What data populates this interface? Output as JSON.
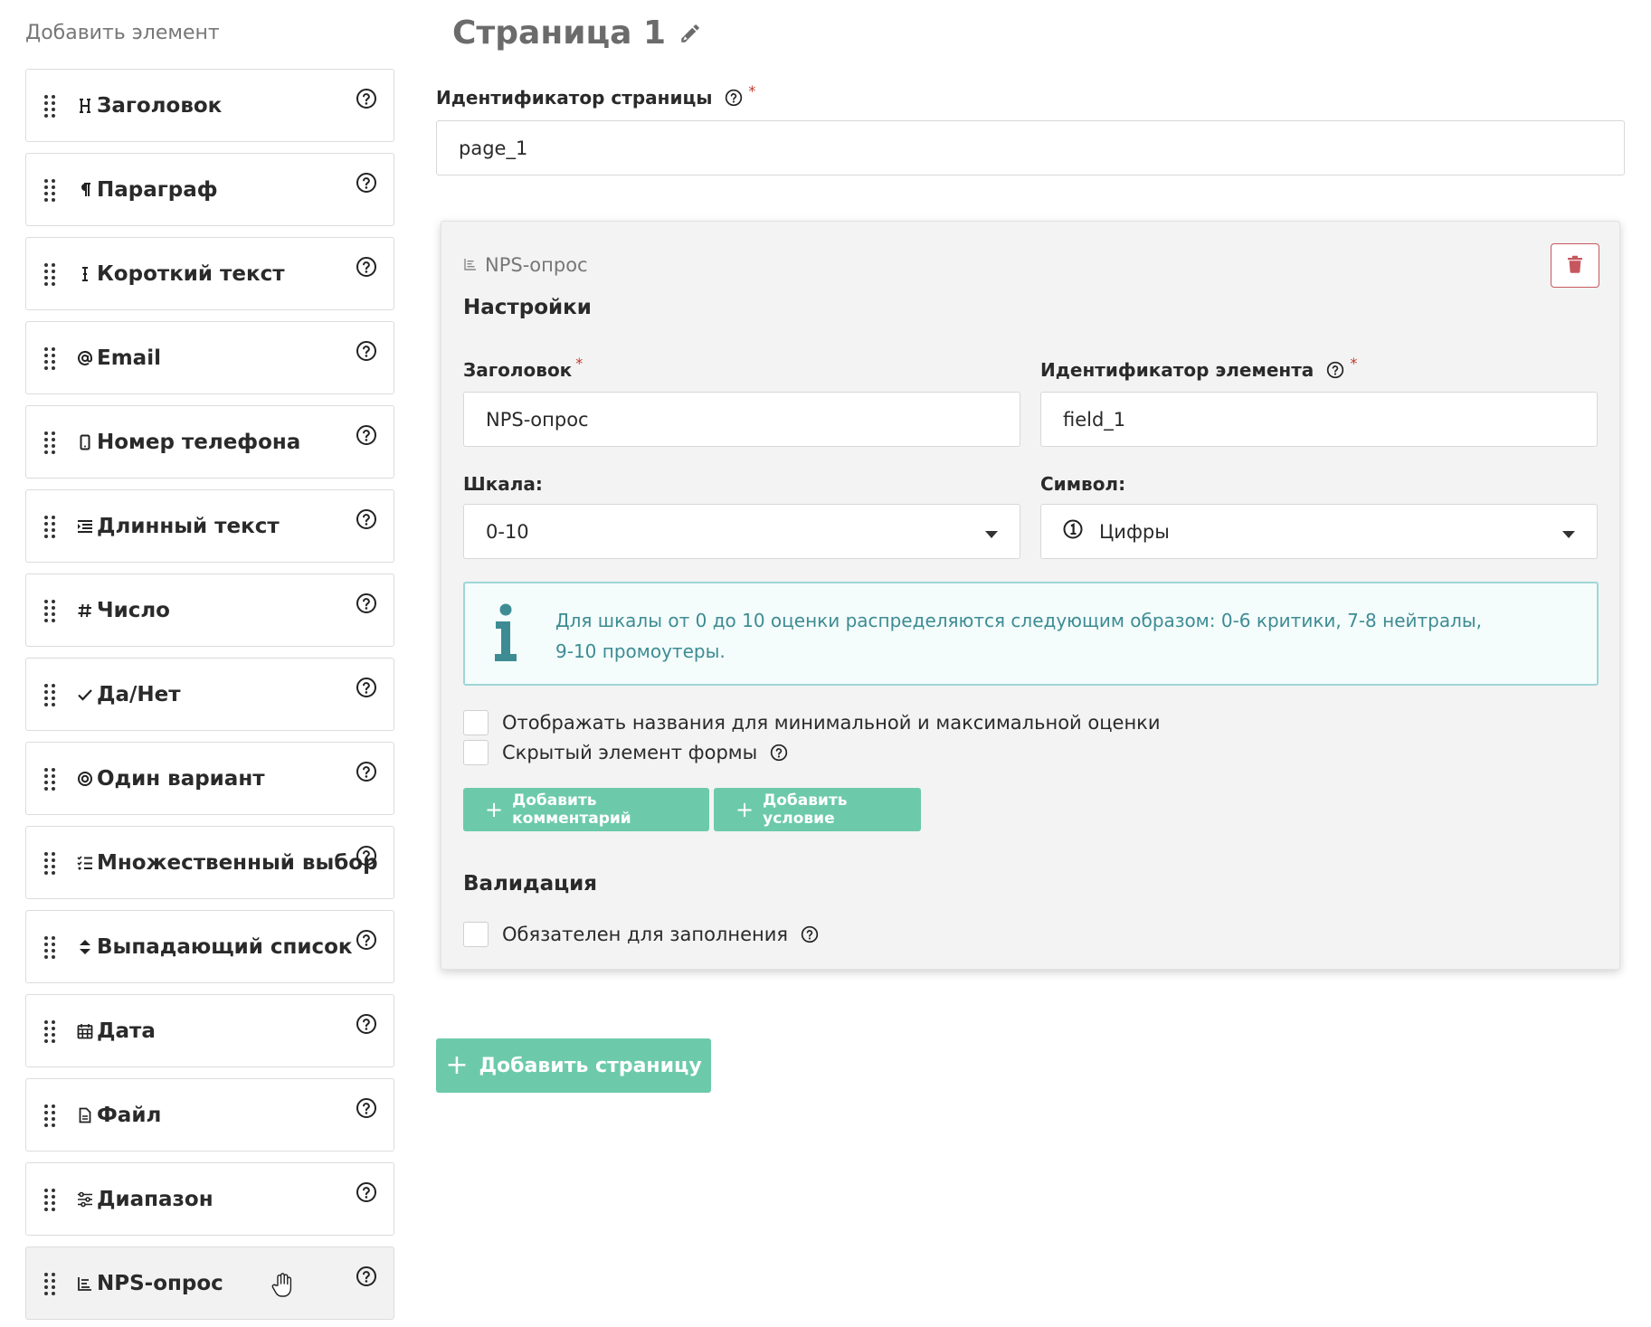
{
  "palette": {
    "title": "Добавить элемент",
    "items": [
      {
        "label": "Заголовок",
        "icon": "heading-icon"
      },
      {
        "label": "Параграф",
        "icon": "paragraph-icon"
      },
      {
        "label": "Короткий текст",
        "icon": "text-cursor-icon"
      },
      {
        "label": "Email",
        "icon": "at-icon"
      },
      {
        "label": "Номер телефона",
        "icon": "mobile-phone-icon"
      },
      {
        "label": "Длинный текст",
        "icon": "long-text-icon"
      },
      {
        "label": "Число",
        "icon": "hash-icon"
      },
      {
        "label": "Да/Нет",
        "icon": "check-icon"
      },
      {
        "label": "Один вариант",
        "icon": "radio-icon"
      },
      {
        "label": "Множественный выбор",
        "icon": "checklist-icon"
      },
      {
        "label": "Выпадающий список",
        "icon": "sort-icon"
      },
      {
        "label": "Дата",
        "icon": "calendar-icon"
      },
      {
        "label": "Файл",
        "icon": "file-icon"
      },
      {
        "label": "Диапазон",
        "icon": "sliders-icon"
      },
      {
        "label": "NPS-опрос",
        "icon": "bar-chart-icon"
      }
    ]
  },
  "page": {
    "title": "Страница 1",
    "id_label": "Идентификатор страницы",
    "id_value": "page_1"
  },
  "element": {
    "type_label": "NPS-опрос",
    "settings_heading": "Настройки",
    "title_label": "Заголовок",
    "title_value": "NPS-опрос",
    "id_label": "Идентификатор элемента",
    "id_value": "field_1",
    "scale_label": "Шкала:",
    "scale_value": "0-10",
    "symbol_label": "Символ:",
    "symbol_value": "Цифры",
    "info_text": "Для шкалы от 0 до 10 оценки распределяются следующим образом: 0-6 критики, 7-8 нейтралы, 9-10 промоутеры.",
    "show_names_label": "Отображать названия для минимальной и максимальной оценки",
    "hidden_label": "Скрытый элемент формы",
    "add_comment_label": "Добавить комментарий",
    "add_condition_label": "Добавить условие",
    "validation_heading": "Валидация",
    "required_label": "Обязателен для заполнения",
    "required_mark": "*"
  },
  "add_page_label": "Добавить страницу",
  "colors": {
    "accent_green": "#6ccaaa",
    "danger": "#c7575e",
    "info_border": "#9fd6d7",
    "info_text": "#3d8c93"
  }
}
